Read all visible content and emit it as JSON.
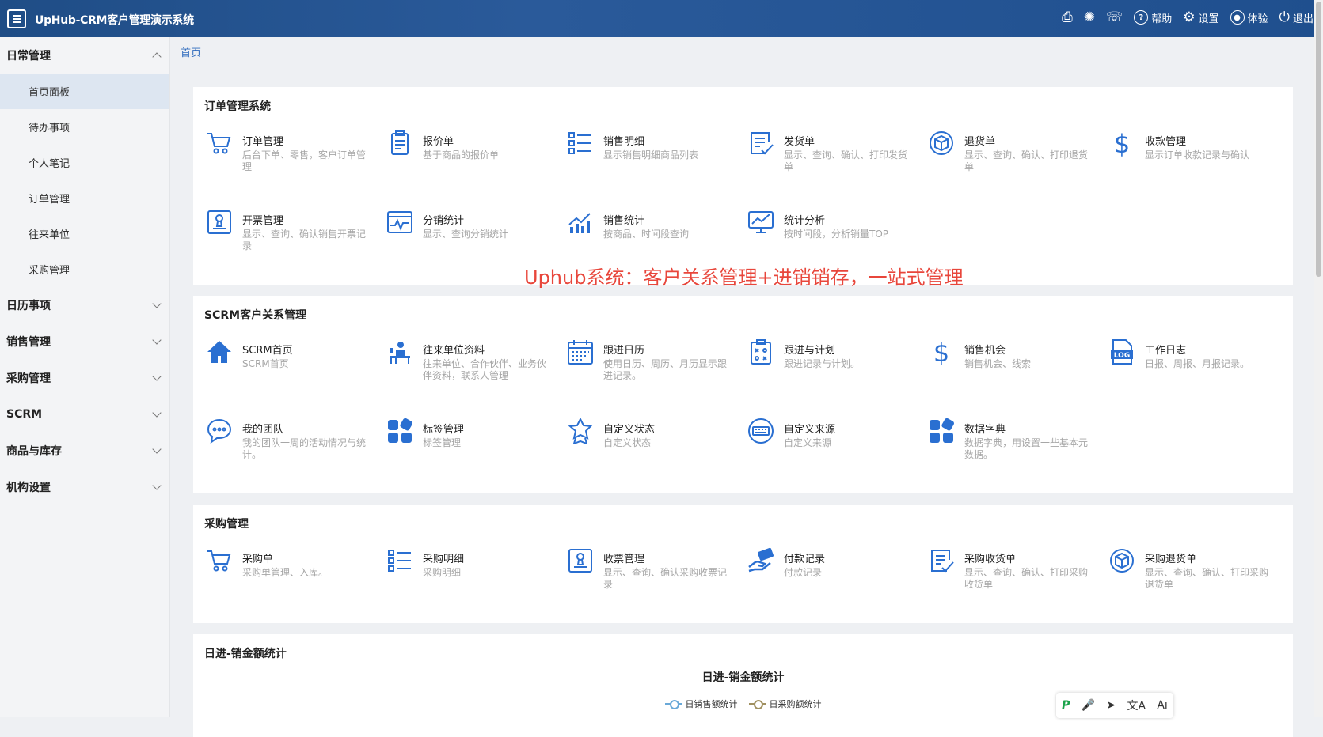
{
  "header": {
    "title": "UpHub-CRM客户管理演示系统",
    "actions": [
      {
        "icon": "printer-icon",
        "label": ""
      },
      {
        "icon": "bulb-icon",
        "label": ""
      },
      {
        "icon": "chat-icon",
        "label": ""
      },
      {
        "icon": "help-icon",
        "label": "帮助"
      },
      {
        "icon": "gear-icon",
        "label": "设置"
      },
      {
        "icon": "experience-icon",
        "label": "体验"
      },
      {
        "icon": "power-icon",
        "label": "退出"
      }
    ]
  },
  "sidebar": {
    "groups": [
      {
        "label": "日常管理",
        "expanded": true,
        "items": [
          "首页面板",
          "待办事项",
          "个人笔记",
          "订单管理",
          "往来单位",
          "采购管理"
        ]
      },
      {
        "label": "日历事项",
        "expanded": false
      },
      {
        "label": "销售管理",
        "expanded": false
      },
      {
        "label": "采购管理",
        "expanded": false
      },
      {
        "label": "SCRM",
        "expanded": false
      },
      {
        "label": "商品与库存",
        "expanded": false
      },
      {
        "label": "机构设置",
        "expanded": false
      }
    ],
    "active_item": "首页面板"
  },
  "breadcrumb": "首页",
  "sections": [
    {
      "title": "订单管理系统",
      "tiles": [
        {
          "name": "订单管理",
          "desc": "后台下单、零售，客户订单管理",
          "icon": "cart-icon"
        },
        {
          "name": "报价单",
          "desc": "基于商品的报价单",
          "icon": "clipboard-icon"
        },
        {
          "name": "销售明细",
          "desc": "显示销售明细商品列表",
          "icon": "checklist-icon"
        },
        {
          "name": "发货单",
          "desc": "显示、查询、确认、打印发货单",
          "icon": "edit-doc-icon"
        },
        {
          "name": "退货单",
          "desc": "显示、查询、确认、打印退货单",
          "icon": "box-icon"
        },
        {
          "name": "收款管理",
          "desc": "显示订单收款记录与确认",
          "icon": "dollar-icon"
        },
        {
          "name": "开票管理",
          "desc": "显示、查询、确认销售开票记录",
          "icon": "stamp-icon"
        },
        {
          "name": "分销统计",
          "desc": "显示、查询分销统计",
          "icon": "pulse-icon"
        },
        {
          "name": "销售统计",
          "desc": "按商品、时间段查询",
          "icon": "bar-chart-icon"
        },
        {
          "name": "统计分析",
          "desc": "按时间段，分析销量TOP",
          "icon": "monitor-chart-icon"
        }
      ]
    },
    {
      "title": "SCRM客户关系管理",
      "tiles": [
        {
          "name": "SCRM首页",
          "desc": "SCRM首页",
          "icon": "home-icon"
        },
        {
          "name": "往来单位资料",
          "desc": "往来单位、合作伙伴、业务伙伴资料，联系人管理",
          "icon": "contact-desk-icon"
        },
        {
          "name": "跟进日历",
          "desc": "使用日历、周历、月历显示跟进记录。",
          "icon": "calendar-icon"
        },
        {
          "name": "跟进与计划",
          "desc": "跟进记录与计划。",
          "icon": "plan-board-icon"
        },
        {
          "name": "销售机会",
          "desc": "销售机会、线索",
          "icon": "dollar-icon"
        },
        {
          "name": "工作日志",
          "desc": "日报、周报、月报记录。",
          "icon": "log-file-icon"
        },
        {
          "name": "我的团队",
          "desc": "我的团队一周的活动情况与统计。",
          "icon": "chat-bubble-icon"
        },
        {
          "name": "标签管理",
          "desc": "标签管理",
          "icon": "tags-grid-icon"
        },
        {
          "name": "自定义状态",
          "desc": "自定义状态",
          "icon": "badge-icon"
        },
        {
          "name": "自定义来源",
          "desc": "自定义来源",
          "icon": "keyboard-circle-icon"
        },
        {
          "name": "数据字典",
          "desc": "数据字典，用设置一些基本元数据。",
          "icon": "tags-grid-icon"
        }
      ]
    },
    {
      "title": "采购管理",
      "tiles": [
        {
          "name": "采购单",
          "desc": "采购单管理、入库。",
          "icon": "cart-icon"
        },
        {
          "name": "采购明细",
          "desc": "采购明细",
          "icon": "checklist-icon"
        },
        {
          "name": "收票管理",
          "desc": "显示、查询、确认采购收票记录",
          "icon": "stamp-icon"
        },
        {
          "name": "付款记录",
          "desc": "付款记录",
          "icon": "payment-hand-icon"
        },
        {
          "name": "采购收货单",
          "desc": "显示、查询、确认、打印采购收货单",
          "icon": "edit-doc-icon"
        },
        {
          "name": "采购退货单",
          "desc": "显示、查询、确认、打印采购退货单",
          "icon": "box-icon"
        }
      ]
    }
  ],
  "chart_section": {
    "title": "日进-销金额统计",
    "chart_title": "日进-销金额统计",
    "legend": [
      "日销售额统计",
      "日采购额统计"
    ]
  },
  "watermark": "Uphub系统：客户关系管理+进销销存，一站式管理",
  "floatbar": [
    "P",
    "🎤",
    "➤",
    "文A",
    "Aı"
  ],
  "colors": {
    "accent": "#2a6fd1",
    "header": "#234f8b",
    "watermark": "#e8463b"
  }
}
